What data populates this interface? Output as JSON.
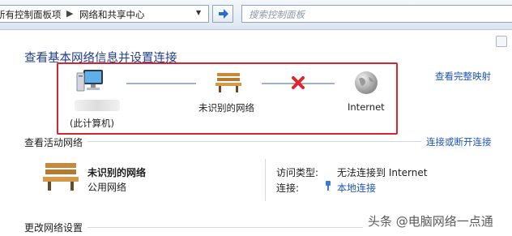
{
  "address": {
    "crumbs": [
      "所有控制面板项",
      "网络和共享中心"
    ],
    "separator": "▶"
  },
  "search": {
    "placeholder": "搜索控制面板"
  },
  "main": {
    "title": "查看基本网络信息并设置连接",
    "full_map_link": "查看完整映射",
    "map": {
      "computer_label": "(此计算机)",
      "network_label": "未识别的网络",
      "internet_label": "Internet"
    },
    "active_networks": {
      "heading": "查看活动网络",
      "connect_link": "连接或断开连接",
      "network_name": "未识别的网络",
      "network_type": "公用网络",
      "access_type_label": "访问类型:",
      "access_type_value": "无法连接到 Internet",
      "connections_label": "连接:",
      "connections_value": "本地连接"
    },
    "change_settings_heading": "更改网络设置"
  },
  "watermark": "头条 @电脑网络一点通",
  "colors": {
    "title": "#1e3c8c",
    "link": "#1f55b8",
    "highlight_box": "#d7252f",
    "error_x": "#e0242b"
  }
}
